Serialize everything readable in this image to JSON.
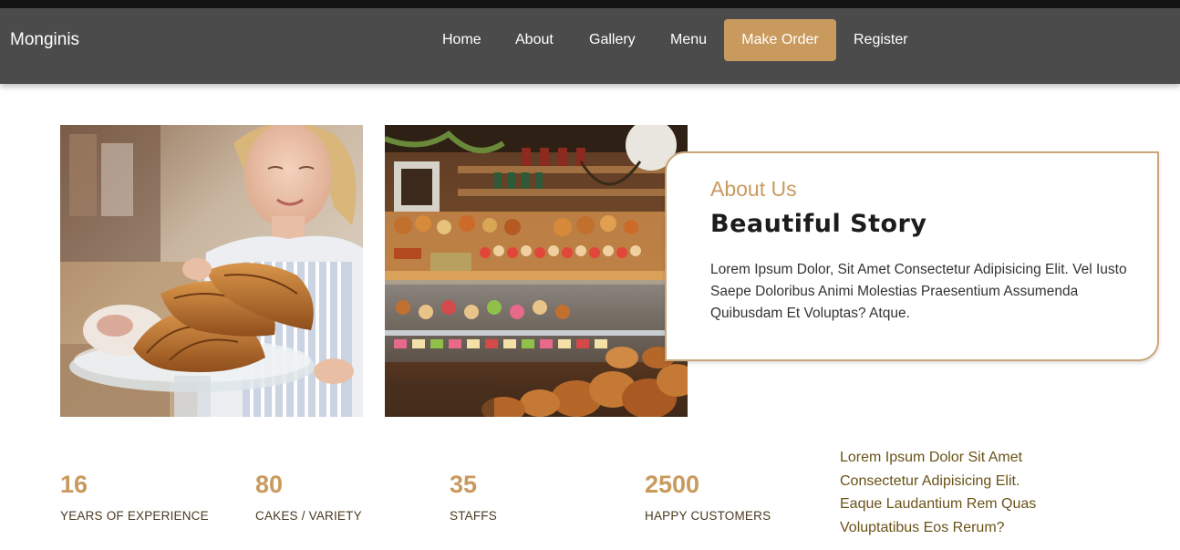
{
  "brand": {
    "name": "Monginis"
  },
  "nav": {
    "items": [
      {
        "label": "Home"
      },
      {
        "label": "About"
      },
      {
        "label": "Gallery"
      },
      {
        "label": "Menu"
      },
      {
        "label": "Make Order"
      },
      {
        "label": "Register"
      }
    ]
  },
  "photos": [
    {
      "subject": "baker-holding-croissants"
    },
    {
      "subject": "bakery-display-case"
    }
  ],
  "about": {
    "kicker": "About Us",
    "title": "Beautiful Story",
    "body": "Lorem Ipsum Dolor, Sit Amet Consectetur Adipisicing Elit. Vel Iusto Saepe Doloribus Animi Molestias Praesentium Assumenda Quibusdam Et Voluptas? Atque."
  },
  "stats": [
    {
      "value": "16",
      "label": "YEARS OF EXPERIENCE"
    },
    {
      "value": "80",
      "label": "CAKES / VARIETY"
    },
    {
      "value": "35",
      "label": "STAFFS"
    },
    {
      "value": "2500",
      "label": "HAPPY CUSTOMERS"
    }
  ],
  "side_text": {
    "line1": "Lorem Ipsum Dolor Sit Amet",
    "line2": "Consectetur Adipisicing Elit.",
    "line3": "Eaque Laudantium Rem Quas",
    "line4": "Voluptatibus Eos Rerum?"
  },
  "colors": {
    "accent": "#c99a5d",
    "navbar": "#4b4b4b",
    "topstrip": "#141414",
    "card_border": "#c9a77a"
  }
}
